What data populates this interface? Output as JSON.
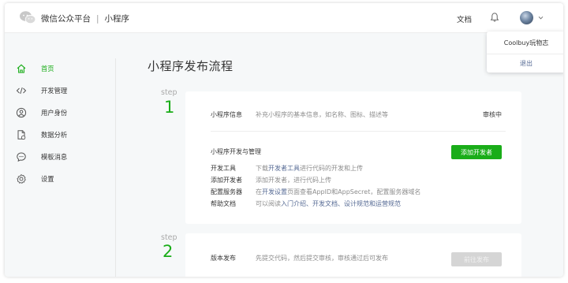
{
  "header": {
    "brand_name": "微信公众平台",
    "separator": "|",
    "section": "小程序",
    "docs_link": "文档"
  },
  "user_menu": {
    "username": "Coolbuy玩物志",
    "logout": "退出"
  },
  "sidebar": {
    "items": [
      {
        "label": "首页",
        "icon": "home-icon",
        "active": true
      },
      {
        "label": "开发管理",
        "icon": "code-icon",
        "active": false
      },
      {
        "label": "用户身份",
        "icon": "user-icon",
        "active": false
      },
      {
        "label": "数据分析",
        "icon": "chart-doc-icon",
        "active": false
      },
      {
        "label": "模板消息",
        "icon": "message-icon",
        "active": false
      },
      {
        "label": "设置",
        "icon": "gear-icon",
        "active": false
      }
    ]
  },
  "main": {
    "title": "小程序发布流程",
    "steps": [
      {
        "word": "step",
        "number": "1",
        "info": {
          "title": "小程序信息",
          "desc": "补充小程序的基本信息，如名称、图标、描述等",
          "status": "审核中"
        },
        "dev": {
          "title": "小程序开发与管理",
          "button": "添加开发者",
          "rows": [
            {
              "label": "开发工具",
              "pre": "下载",
              "link": "开发者工具",
              "post": "进行代码的开发和上传"
            },
            {
              "label": "添加开发者",
              "pre": "添加开发者，进行代码上传",
              "link": "",
              "post": ""
            },
            {
              "label": "配置服务器",
              "pre": "在",
              "link": "开发设置",
              "post": "页面查看AppID和AppSecret，配置服务器域名"
            },
            {
              "label": "帮助文档",
              "pre": "可以阅读",
              "link": "入门介绍、开发文档、设计规范和运营规范",
              "post": ""
            }
          ]
        }
      },
      {
        "word": "step",
        "number": "2",
        "release": {
          "title": "版本发布",
          "desc": "先提交代码，然后提交审核，审核通过后可发布",
          "button": "前往发布"
        }
      }
    ]
  },
  "colors": {
    "accent": "#1aad19",
    "link": "#576b95",
    "background": "#f6f8f9"
  }
}
